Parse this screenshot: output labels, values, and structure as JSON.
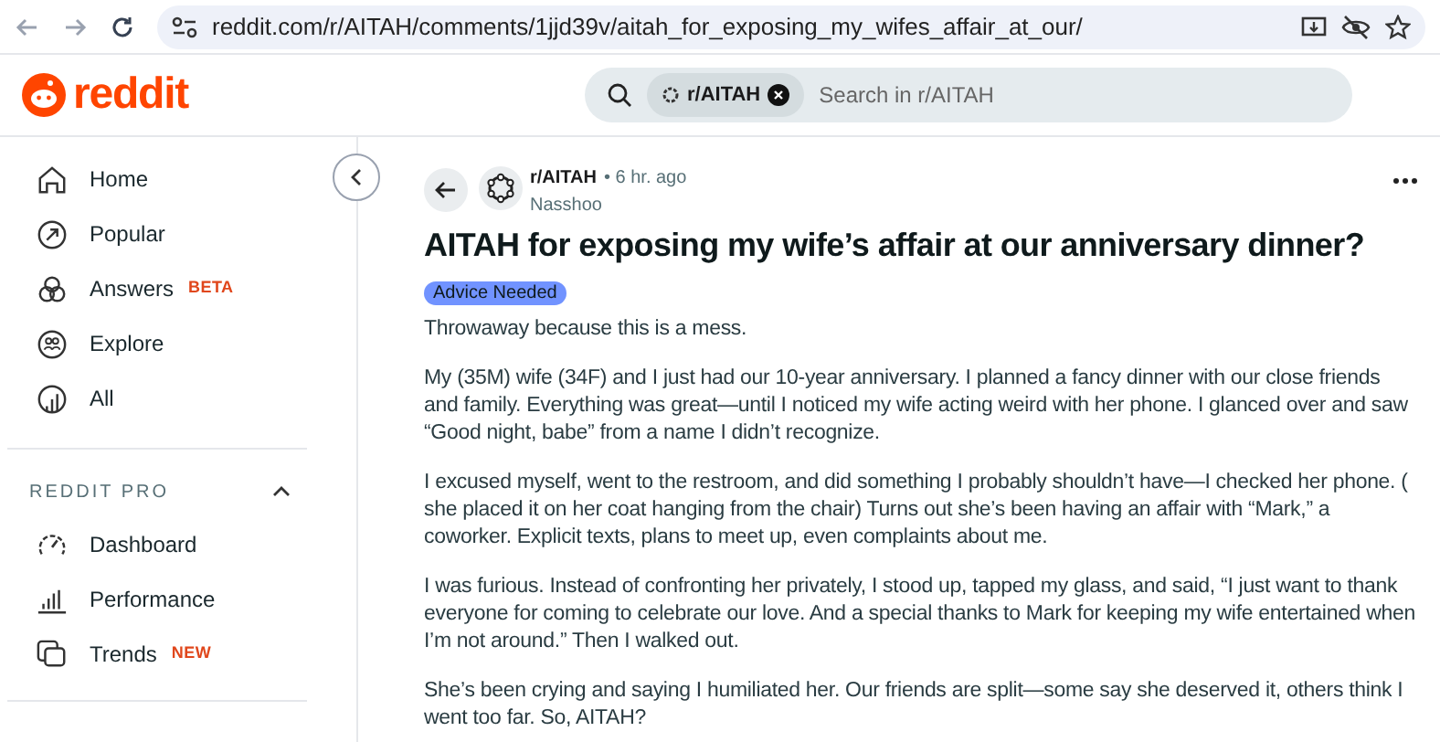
{
  "browser": {
    "url": "reddit.com/r/AITAH/comments/1jjd39v/aitah_for_exposing_my_wifes_affair_at_our/"
  },
  "header": {
    "logo": "reddit",
    "search": {
      "chip": "r/AITAH",
      "placeholder": "Search in r/AITAH"
    }
  },
  "sidebar": {
    "items": [
      {
        "label": "Home"
      },
      {
        "label": "Popular"
      },
      {
        "label": "Answers",
        "badge": "BETA"
      },
      {
        "label": "Explore"
      },
      {
        "label": "All"
      }
    ],
    "sections": [
      {
        "title": "REDDIT PRO",
        "expanded": true,
        "items": [
          {
            "label": "Dashboard"
          },
          {
            "label": "Performance"
          },
          {
            "label": "Trends",
            "badge": "NEW"
          }
        ]
      }
    ]
  },
  "post": {
    "subreddit": "r/AITAH",
    "time": "• 6 hr. ago",
    "author": "Nasshoo",
    "title": "AITAH for exposing my wife’s affair at our anniversary dinner?",
    "flair": "Advice Needed",
    "paragraphs": [
      "Throwaway because this is a mess.",
      "My (35M) wife (34F) and I just had our 10-year anniversary. I planned a fancy dinner with our close friends and family. Everything was great—until I noticed my wife acting weird with her phone. I glanced over and saw “Good night, babe” from a name I didn’t recognize.",
      "I excused myself, went to the restroom, and did something I probably shouldn’t have—I checked her phone. ( she placed it on her coat hanging from the chair) Turns out she’s been having an affair with “Mark,” a coworker. Explicit texts, plans to meet up, even complaints about me.",
      "I was furious. Instead of confronting her privately, I stood up, tapped my glass, and said, “I just want to thank everyone for coming to celebrate our love. And a special thanks to Mark for keeping my wife entertained when I’m not around.” Then I walked out.",
      "She’s been crying and saying I humiliated her. Our friends are split—some say she deserved it, others think I went too far. So, AITAH?"
    ]
  }
}
